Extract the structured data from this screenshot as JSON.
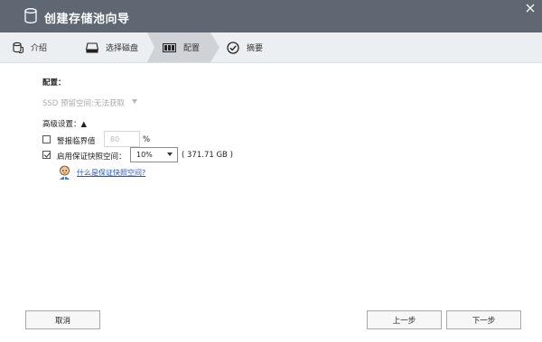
{
  "window": {
    "title": "创建存储池向导"
  },
  "steps": [
    {
      "label": "介绍",
      "icon": "disks-icon",
      "active": false
    },
    {
      "label": "选择磁盘",
      "icon": "disk-drive-icon",
      "active": false
    },
    {
      "label": "配置",
      "icon": "raid-config-icon",
      "active": true
    },
    {
      "label": "摘要",
      "icon": "check-circle-icon",
      "active": false
    }
  ],
  "config": {
    "heading": "配置：",
    "ssd_label": "SSD 预留空间:",
    "ssd_value": "无法获取",
    "advanced_label": "高级设置：▲",
    "alert_threshold": {
      "label": "警报临界值",
      "value": "80",
      "unit": "%",
      "checked": false
    },
    "reserve_snapshot": {
      "label": "启用保证快照空间：",
      "selected": "10%",
      "size": "( 371.71 GB )",
      "checked": true
    },
    "help_link": "什么是保证快照空间?"
  },
  "buttons": {
    "cancel": "取消",
    "prev": "上一步",
    "next": "下一步"
  },
  "colors": {
    "titlebar": "#5f6773",
    "stepbar": "#eceff1",
    "link": "#2255cc"
  }
}
